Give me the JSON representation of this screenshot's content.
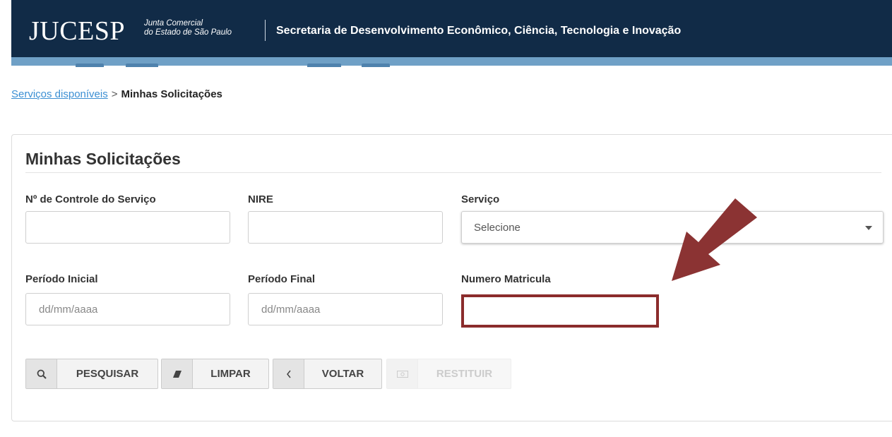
{
  "header": {
    "logo": "JUCESP",
    "logo_sub_line1": "Junta Comercial",
    "logo_sub_line2": "do Estado de São Paulo",
    "title": "Secretaria de Desenvolvimento Econômico, Ciência, Tecnologia e Inovação",
    "bg_color": "#112b47",
    "band_color": "#6fa0c6"
  },
  "breadcrumb": {
    "link": "Serviços disponíveis",
    "separator": ">",
    "current": "Minhas Solicitações"
  },
  "panel": {
    "title": "Minhas Solicitações"
  },
  "form": {
    "controle_label": "Nº de Controle do Serviço",
    "controle_value": "",
    "nire_label": "NIRE",
    "nire_value": "",
    "servico_label": "Serviço",
    "servico_selected": "Selecione",
    "periodo_inicial_label": "Período Inicial",
    "periodo_inicial_placeholder": "dd/mm/aaaa",
    "periodo_final_label": "Período Final",
    "periodo_final_placeholder": "dd/mm/aaaa",
    "matricula_label": "Numero Matricula",
    "matricula_value": ""
  },
  "buttons": {
    "pesquisar": {
      "label": "PESQUISAR",
      "icon": "search-icon"
    },
    "limpar": {
      "label": "LIMPAR",
      "icon": "eraser-icon"
    },
    "voltar": {
      "label": "VOLTAR",
      "icon": "chevron-left-icon"
    },
    "restituir": {
      "label": "RESTITUIR",
      "icon": "money-icon",
      "disabled": true
    }
  },
  "annotation": {
    "arrow_color": "#8b3333",
    "highlight_color": "#8b2c2c"
  }
}
